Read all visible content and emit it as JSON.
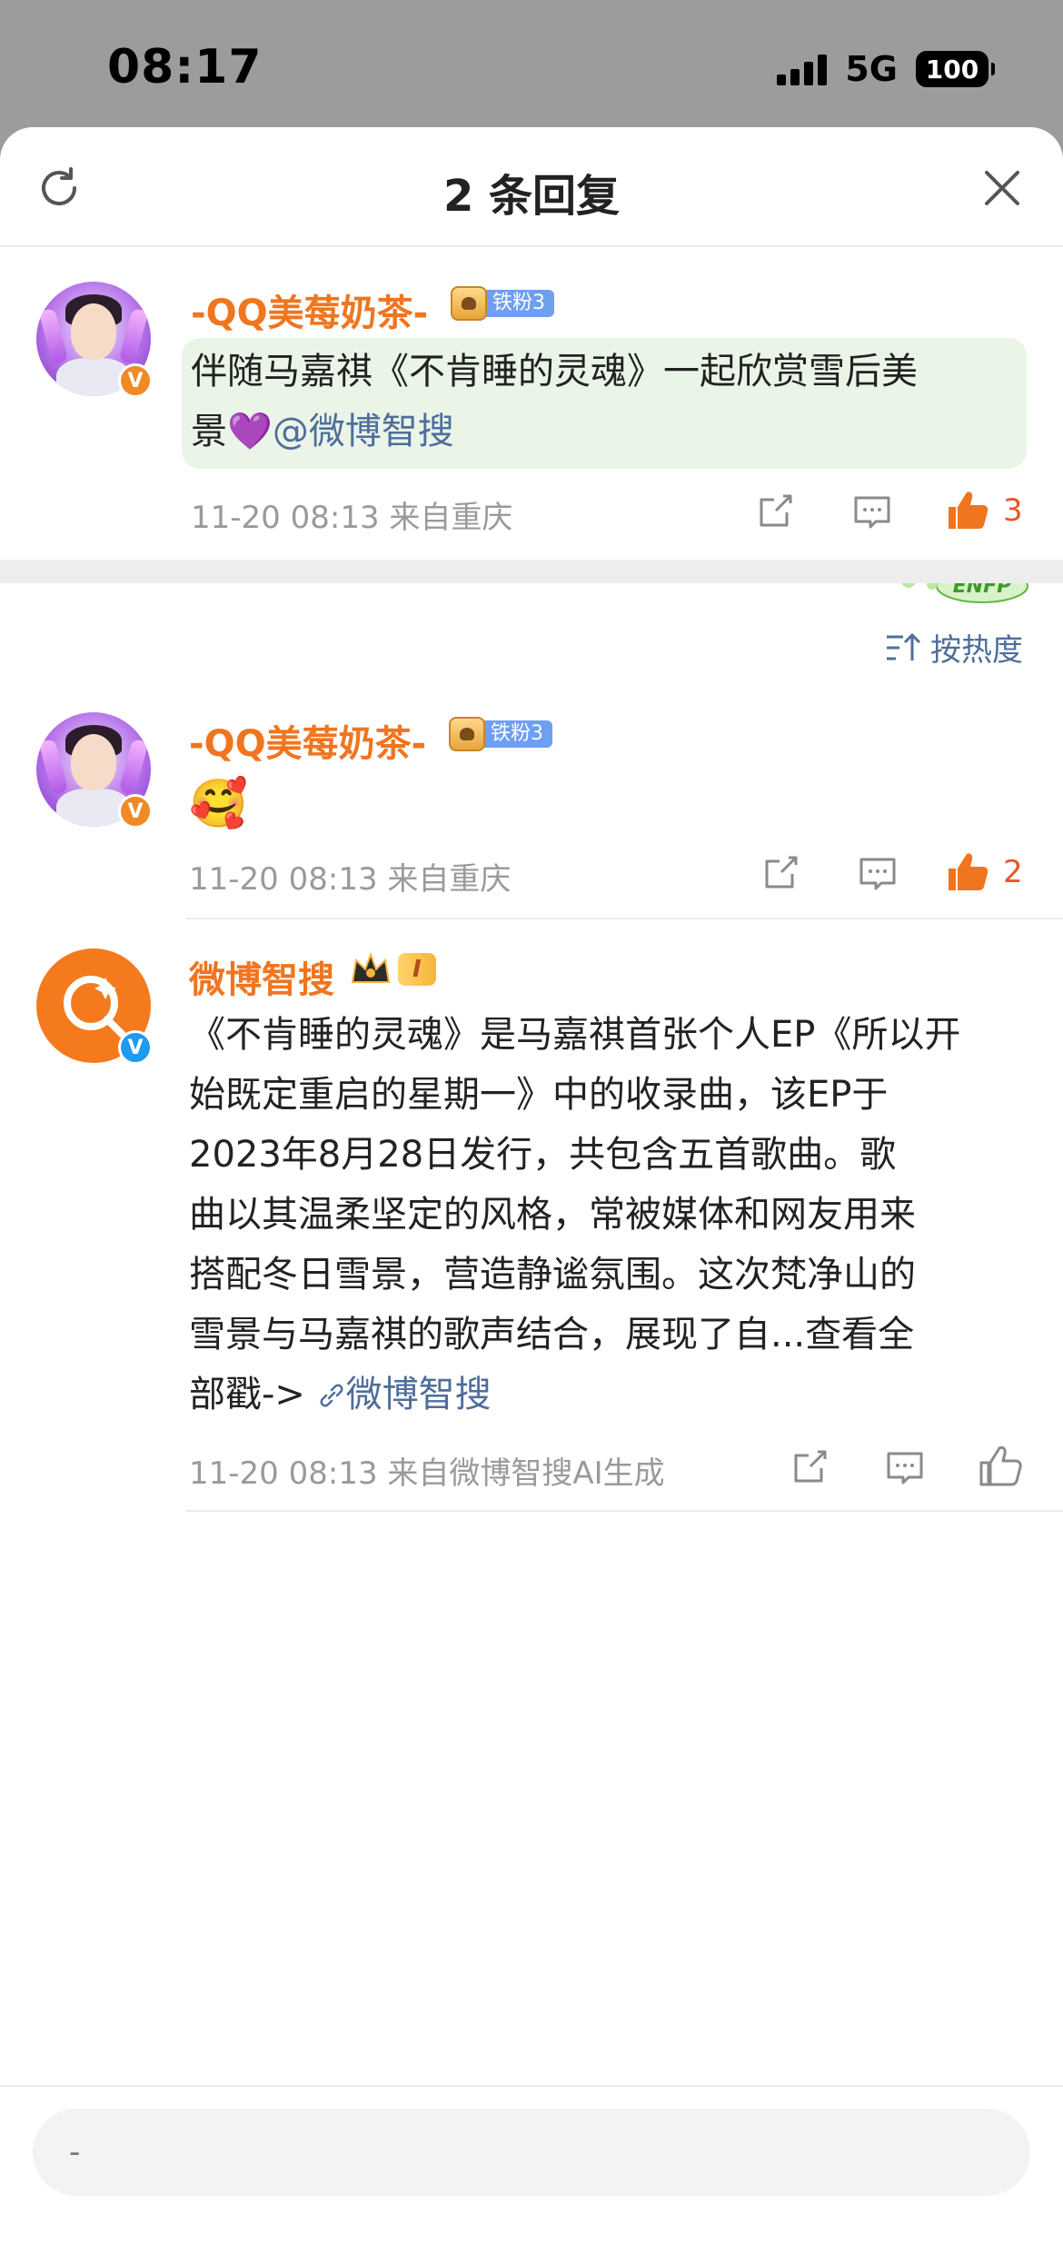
{
  "status_bar": {
    "time": "08:17",
    "network": "5G",
    "battery": "100"
  },
  "sheet": {
    "title": "2 条回复"
  },
  "main_comment": {
    "username": "-QQ美莓奶茶-",
    "fan_badge": "铁粉3",
    "text_lines": [
      "伴随马嘉祺《不肯睡的灵魂》一起欣赏雪后美",
      "景"
    ],
    "emoji": "💜",
    "mention": "@微博智搜",
    "meta": "11-20 08:13 来自重庆",
    "likes": "3",
    "sticker": "ENFP"
  },
  "sort": {
    "label": "按热度"
  },
  "replies": [
    {
      "username": "-QQ美莓奶茶-",
      "fan_badge": "铁粉3",
      "emoji": "🥰",
      "meta": "11-20 08:13 来自重庆",
      "likes": "2"
    },
    {
      "username": "微博智搜",
      "vip_level": "I",
      "text_lines": [
        "《不肯睡的灵魂》是马嘉祺首张个人EP《所以开",
        "始既定重启的星期一》中的收录曲，该EP于",
        "2023年8月28日发行，共包含五首歌曲。歌",
        "曲以其温柔坚定的风格，常被媒体和网友用来",
        "搭配冬日雪景，营造静谧氛围。这次梵净山的",
        "雪景与马嘉祺的歌声结合，展现了自...查看全"
      ],
      "last_line_prefix": "部戳->",
      "link_text": "微博智搜",
      "meta": "11-20 08:13 来自微博智搜AI生成"
    }
  ],
  "input": {
    "placeholder": "-"
  },
  "colors": {
    "username": "#f0751f",
    "link": "#4f6e9a",
    "like_active": "#e5572b",
    "bubble": "#eaf5e8"
  }
}
